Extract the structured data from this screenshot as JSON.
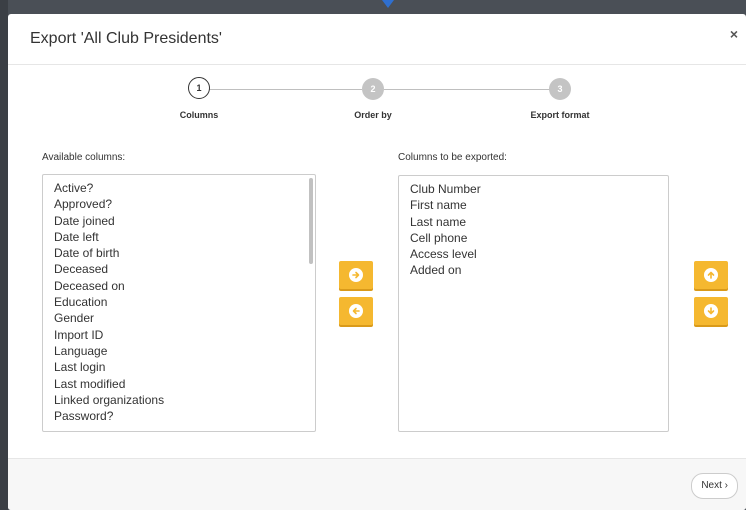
{
  "dialog": {
    "title": "Export 'All Club Presidents'",
    "close_glyph": "×"
  },
  "stepper": {
    "steps": [
      {
        "number": "1",
        "label": "Columns",
        "state": "active"
      },
      {
        "number": "2",
        "label": "Order by",
        "state": "inactive"
      },
      {
        "number": "3",
        "label": "Export format",
        "state": "inactive"
      }
    ]
  },
  "available": {
    "label": "Available columns:",
    "items": [
      "Active?",
      "Approved?",
      "Date joined",
      "Date left",
      "Date of birth",
      "Deceased",
      "Deceased on",
      "Education",
      "Gender",
      "Import ID",
      "Language",
      "Last login",
      "Last modified",
      "Linked organizations",
      "Password?"
    ]
  },
  "exported": {
    "label": "Columns to be exported:",
    "items": [
      "Club Number",
      "First name",
      "Last name",
      "Cell phone",
      "Access level",
      "Added on"
    ]
  },
  "buttons": {
    "add_icon": "arrow-right-icon",
    "remove_icon": "arrow-left-icon",
    "up_icon": "arrow-up-icon",
    "down_icon": "arrow-down-icon",
    "next_label": "Next ›"
  },
  "colors": {
    "accent": "#f5b830",
    "step_inactive": "#c4c4c4"
  }
}
